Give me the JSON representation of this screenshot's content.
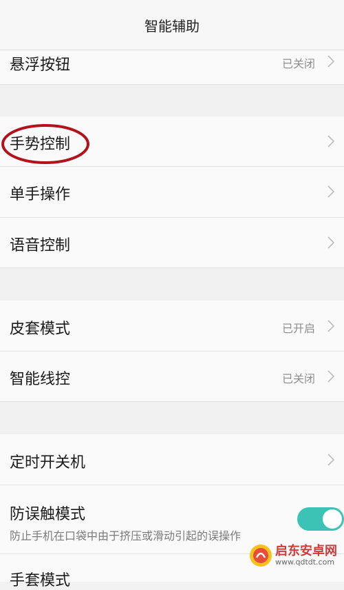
{
  "header": {
    "title": "智能辅助"
  },
  "rows": {
    "floating_button": {
      "label": "悬浮按钮",
      "status": "已关闭"
    },
    "gesture_control": {
      "label": "手势控制"
    },
    "one_hand": {
      "label": "单手操作"
    },
    "voice_control": {
      "label": "语音控制"
    },
    "cover_mode": {
      "label": "皮套模式",
      "status": "已开启"
    },
    "smart_remote": {
      "label": "智能线控",
      "status": "已关闭"
    },
    "scheduled_power": {
      "label": "定时开关机"
    },
    "anti_touch": {
      "label": "防误触模式",
      "description": "防止手机在口袋中由于挤压或滑动引起的误操作",
      "toggle_state": "on"
    },
    "partial_next": {
      "label": "手套模式"
    }
  },
  "watermark": {
    "main": "启东安卓网",
    "url": "www.qdtdt.com"
  },
  "colors": {
    "accent_toggle": "#3cc3b5",
    "highlight_circle": "#b3121c",
    "background": "#f2f2f2",
    "row_background": "#fafafa"
  }
}
